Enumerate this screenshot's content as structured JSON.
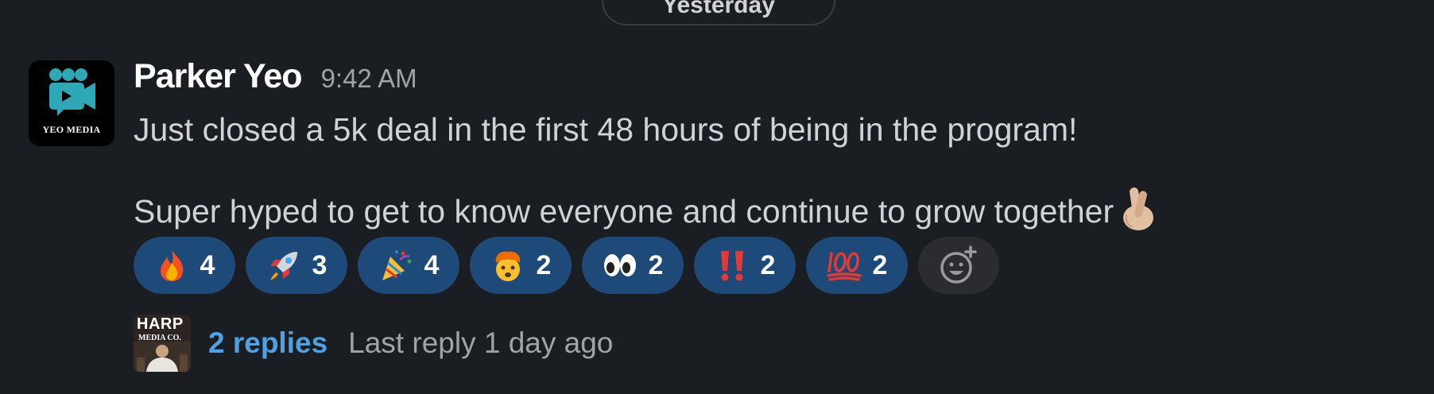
{
  "date_divider": {
    "label": "Yesterday"
  },
  "message": {
    "author": "Parker Yeo",
    "timestamp": "9:42 AM",
    "avatar": {
      "caption": "YEO MEDIA",
      "icon": "film-camera-people-icon",
      "color": "#2ea8b6"
    },
    "lines": [
      "Just closed a 5k deal in the first 48 hours of being in the program!",
      "Super hyped to get to know everyone and continue to grow together"
    ],
    "trailing_emoji": "crossed-fingers-icon"
  },
  "reactions": [
    {
      "emoji": "fire-icon",
      "count": "4"
    },
    {
      "emoji": "rocket-icon",
      "count": "3"
    },
    {
      "emoji": "party-popper-icon",
      "count": "4"
    },
    {
      "emoji": "exploding-head-icon",
      "count": "2"
    },
    {
      "emoji": "eyes-icon",
      "count": "2"
    },
    {
      "emoji": "double-exclamation-icon",
      "count": "2"
    },
    {
      "emoji": "hundred-points-icon",
      "count": "2"
    }
  ],
  "add_reaction": {
    "icon": "add-emoji-icon"
  },
  "thread": {
    "replier_avatar": {
      "title": "HARP",
      "subtitle": "MEDIA CO."
    },
    "replies_label": "2 replies",
    "last_reply": "Last reply 1 day ago"
  },
  "colors": {
    "background": "#1a1d21",
    "reaction_bg": "#1d4a78",
    "link": "#4ea2e4"
  }
}
